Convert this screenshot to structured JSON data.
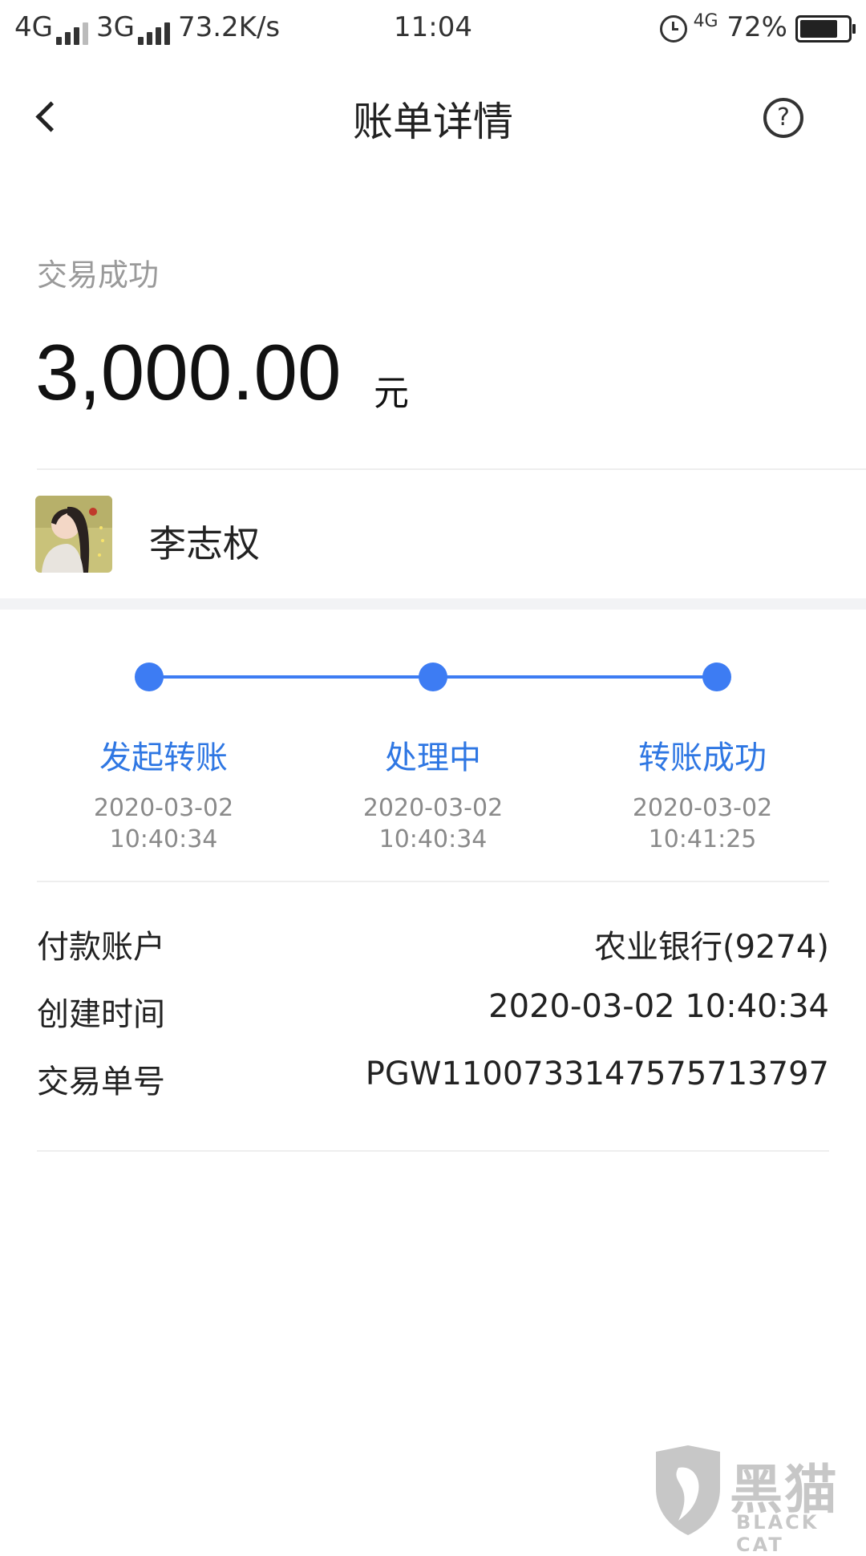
{
  "status_bar": {
    "network1": "4G",
    "network2": "3G",
    "speed": "73.2K/s",
    "time": "11:04",
    "network3": "4G",
    "battery": "72%"
  },
  "header": {
    "title": "账单详情",
    "help_glyph": "?"
  },
  "summary": {
    "status": "交易成功",
    "amount": "3,000.00",
    "unit": "元"
  },
  "recipient": {
    "name": "李志权"
  },
  "progress": {
    "steps": [
      {
        "label": "发起转账",
        "date": "2020-03-02",
        "time": "10:40:34"
      },
      {
        "label": "处理中",
        "date": "2020-03-02",
        "time": "10:40:34"
      },
      {
        "label": "转账成功",
        "date": "2020-03-02",
        "time": "10:41:25"
      }
    ]
  },
  "details": [
    {
      "label": "付款账户",
      "value": "农业银行(9274)"
    },
    {
      "label": "创建时间",
      "value": "2020-03-02 10:40:34"
    },
    {
      "label": "交易单号",
      "value": "PGW1100733147575713797"
    }
  ],
  "watermark": {
    "text": "黑猫",
    "sub": "BLACK CAT"
  },
  "colors": {
    "accent": "#3d7cf3",
    "step_label": "#2f77e3",
    "muted": "#9a9a9a"
  }
}
